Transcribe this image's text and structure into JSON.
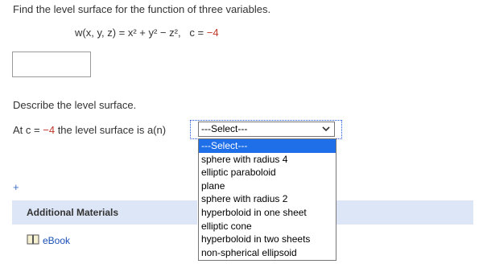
{
  "question": {
    "prompt": "Find the level surface for the function of three variables.",
    "equation": "w(x, y, z) = x² + y² − z²,",
    "c_label": "c =",
    "c_value": "−4"
  },
  "answer_box": {
    "value": ""
  },
  "describe": {
    "text": "Describe the level surface.",
    "at_c_prefix": "At c =",
    "at_c_value": "−4",
    "at_c_suffix": "the level surface is a(n)"
  },
  "select": {
    "current": "---Select---",
    "options": [
      "---Select---",
      "sphere with radius 4",
      "elliptic paraboloid",
      "plane",
      "sphere with radius 2",
      "hyperboloid in one sheet",
      "elliptic cone",
      "hyperboloid in two sheets",
      "non-spherical ellipsoid"
    ],
    "highlighted_index": 0
  },
  "materials": {
    "expand_icon": "+",
    "title": "Additional Materials",
    "ebook_label": "eBook",
    "ebook_icon": "book-icon"
  },
  "colors": {
    "accent_red": "#c0392b",
    "link_blue": "#1a4fb8",
    "materials_bg": "#dde6f7",
    "select_highlight": "#1e6fe8"
  }
}
